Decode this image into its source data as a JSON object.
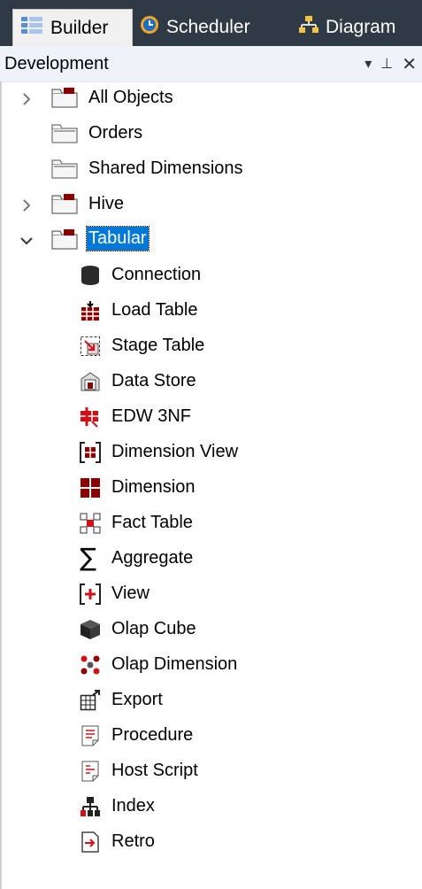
{
  "tabs": [
    {
      "label": "Builder",
      "icon": "builder-icon",
      "active": true
    },
    {
      "label": "Scheduler",
      "icon": "scheduler-icon",
      "active": false
    },
    {
      "label": "Diagram",
      "icon": "diagram-icon",
      "active": false
    }
  ],
  "panel": {
    "title": "Development",
    "controls": {
      "dropdown": "▾",
      "pin": "⊥",
      "close": "✕"
    }
  },
  "tree": {
    "groups": [
      {
        "label": "All Objects",
        "expander": "›"
      },
      {
        "label": "Orders",
        "expander": ""
      },
      {
        "label": "Shared Dimensions",
        "expander": ""
      },
      {
        "label": "Hive",
        "expander": "›"
      },
      {
        "label": "Tabular",
        "expander": "⌄",
        "selected": true
      }
    ],
    "children": [
      {
        "label": "Connection",
        "icon": "connection-icon"
      },
      {
        "label": "Load Table",
        "icon": "load-table-icon"
      },
      {
        "label": "Stage Table",
        "icon": "stage-table-icon"
      },
      {
        "label": "Data Store",
        "icon": "data-store-icon"
      },
      {
        "label": "EDW 3NF",
        "icon": "edw-3nf-icon"
      },
      {
        "label": "Dimension View",
        "icon": "dimension-view-icon"
      },
      {
        "label": "Dimension",
        "icon": "dimension-icon"
      },
      {
        "label": "Fact Table",
        "icon": "fact-table-icon"
      },
      {
        "label": "Aggregate",
        "icon": "aggregate-icon"
      },
      {
        "label": "View",
        "icon": "view-icon"
      },
      {
        "label": "Olap Cube",
        "icon": "olap-cube-icon"
      },
      {
        "label": "Olap Dimension",
        "icon": "olap-dimension-icon"
      },
      {
        "label": "Export",
        "icon": "export-icon"
      },
      {
        "label": "Procedure",
        "icon": "procedure-icon"
      },
      {
        "label": "Host Script",
        "icon": "host-script-icon"
      },
      {
        "label": "Index",
        "icon": "index-icon"
      },
      {
        "label": "Retro",
        "icon": "retro-icon"
      }
    ]
  },
  "colors": {
    "accent": "#0078d7",
    "dark_red": "#8b0000",
    "red": "#d01018",
    "topbar": "#2f3a45"
  }
}
